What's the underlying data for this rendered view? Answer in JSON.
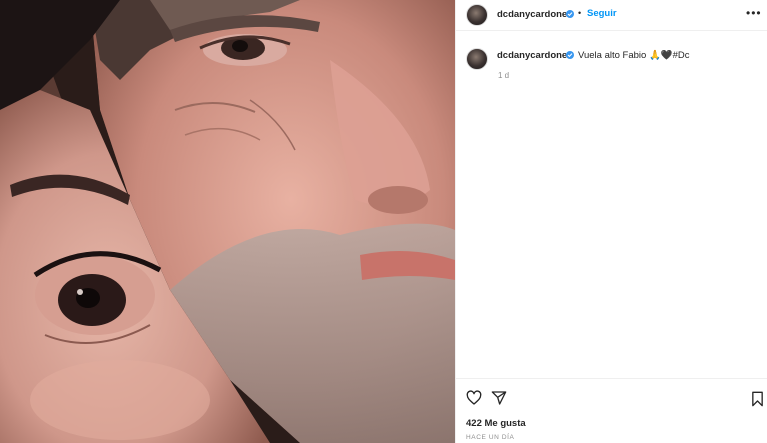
{
  "post": {
    "username": "dcdanycardone",
    "follow_label": "Seguir",
    "separator": "•",
    "more_label": "•••",
    "caption_text": "Vuela alto Fabio 🙏🖤#Dc",
    "comment_time": "1 d",
    "likes_label": "422 Me gusta",
    "posted_ago": "HACE UN DÍA"
  },
  "icons": {
    "like": "heart-icon",
    "share": "paper-plane-icon",
    "save": "bookmark-icon",
    "verified": "verified-badge-icon"
  },
  "colors": {
    "accent": "#0095f6",
    "verified": "#3897f0",
    "text": "#262626",
    "muted": "#8e8e8e"
  }
}
